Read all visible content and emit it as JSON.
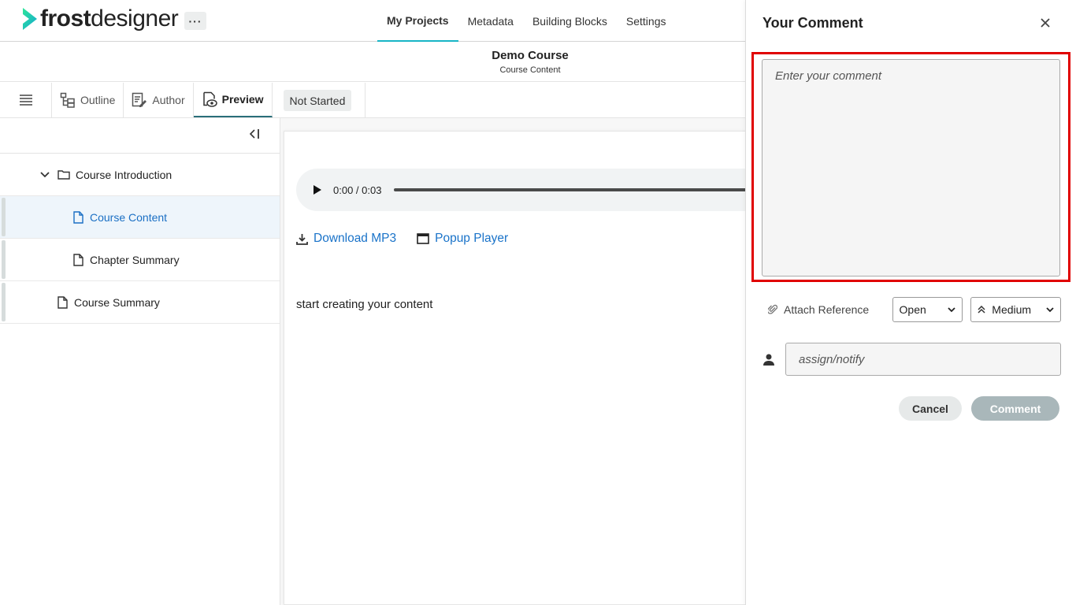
{
  "app": {
    "logo_bold": "frost",
    "logo_light": "designer",
    "more_label": "···",
    "brand_colors": {
      "accent": "#18b5c6",
      "logo_gradient": [
        "#1fd6a0",
        "#16b3c8"
      ]
    }
  },
  "nav": {
    "items": [
      {
        "label": "My Projects",
        "active": true
      },
      {
        "label": "Metadata"
      },
      {
        "label": "Building Blocks"
      },
      {
        "label": "Settings"
      }
    ]
  },
  "course": {
    "title": "Demo Course",
    "subtitle": "Course Content"
  },
  "toolbar": {
    "menu_icon": "hamburger-icon",
    "tabs": [
      {
        "label": "Outline",
        "icon": "outline-icon"
      },
      {
        "label": "Author",
        "icon": "author-icon"
      },
      {
        "label": "Preview",
        "icon": "preview-icon",
        "active": true
      }
    ],
    "status": "Not Started"
  },
  "sidebar": {
    "collapse_icon": "collapse-left-icon",
    "items": [
      {
        "label": "Course Introduction",
        "icon": "folder-icon",
        "expanded": true
      },
      {
        "label": "Course Content",
        "icon": "file-icon",
        "selected": true
      },
      {
        "label": "Chapter Summary",
        "icon": "file-icon"
      },
      {
        "label": "Course Summary",
        "icon": "file-icon"
      }
    ]
  },
  "content": {
    "audio_time": "0:00 / 0:03",
    "download_label": "Download MP3",
    "popup_label": "Popup Player",
    "body_text": "start creating your content",
    "link_color": "#1a73c9"
  },
  "comment_panel": {
    "title": "Your Comment",
    "comment_placeholder": "Enter your comment",
    "attach_label": "Attach Reference",
    "status_value": "Open",
    "priority_value": "Medium",
    "assign_placeholder": "assign/notify",
    "cancel_label": "Cancel",
    "submit_label": "Comment",
    "highlight_color": "#e00000"
  }
}
